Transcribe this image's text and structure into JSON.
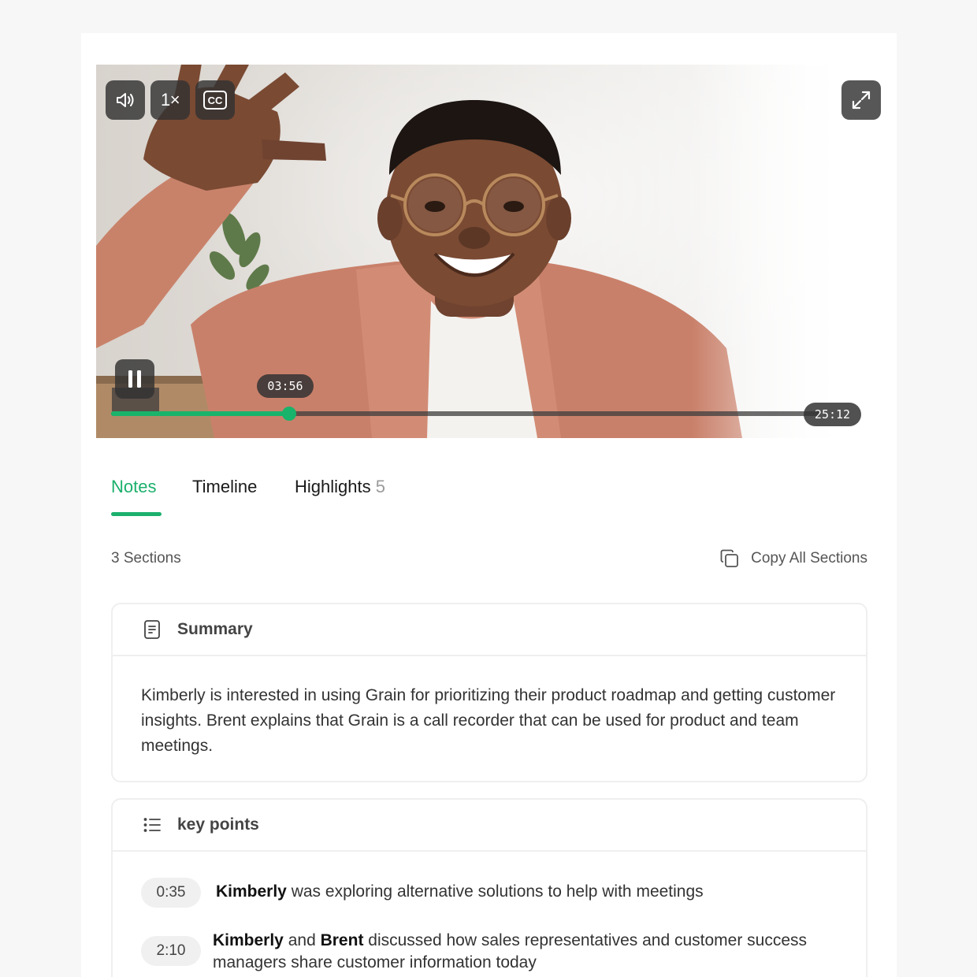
{
  "player": {
    "speed_label": "1×",
    "current_time": "03:56",
    "duration": "25:12",
    "progress_fraction": 0.2513,
    "accent_color": "#19b36b"
  },
  "tabs": [
    {
      "label": "Notes",
      "active": true
    },
    {
      "label": "Timeline",
      "active": false
    },
    {
      "label": "Highlights",
      "count": "5",
      "active": false
    }
  ],
  "notes": {
    "sections_count": "3 Sections",
    "copy_all_label": "Copy All Sections",
    "summary": {
      "title": "Summary",
      "text": "Kimberly is interested in using Grain for prioritizing their product roadmap and getting customer insights. Brent explains that Grain is a call recorder that can be used for product and team meetings."
    },
    "key_points": {
      "title": "key points",
      "items": [
        {
          "time": "0:35",
          "speaker1": "Kimberly",
          "joiner": "",
          "speaker2": "",
          "text": " was exploring alternative solutions to help with meetings"
        },
        {
          "time": "2:10",
          "speaker1": "Kimberly",
          "joiner": " and ",
          "speaker2": "Brent",
          "text": " discussed how sales representatives and customer success managers share customer information today"
        }
      ]
    }
  },
  "icons": {
    "volume": "volume-icon",
    "captions": "closed-captions-icon",
    "fullscreen": "expand-icon",
    "pause": "pause-icon",
    "copy": "copy-icon",
    "summary": "document-icon",
    "key_points": "list-icon"
  }
}
